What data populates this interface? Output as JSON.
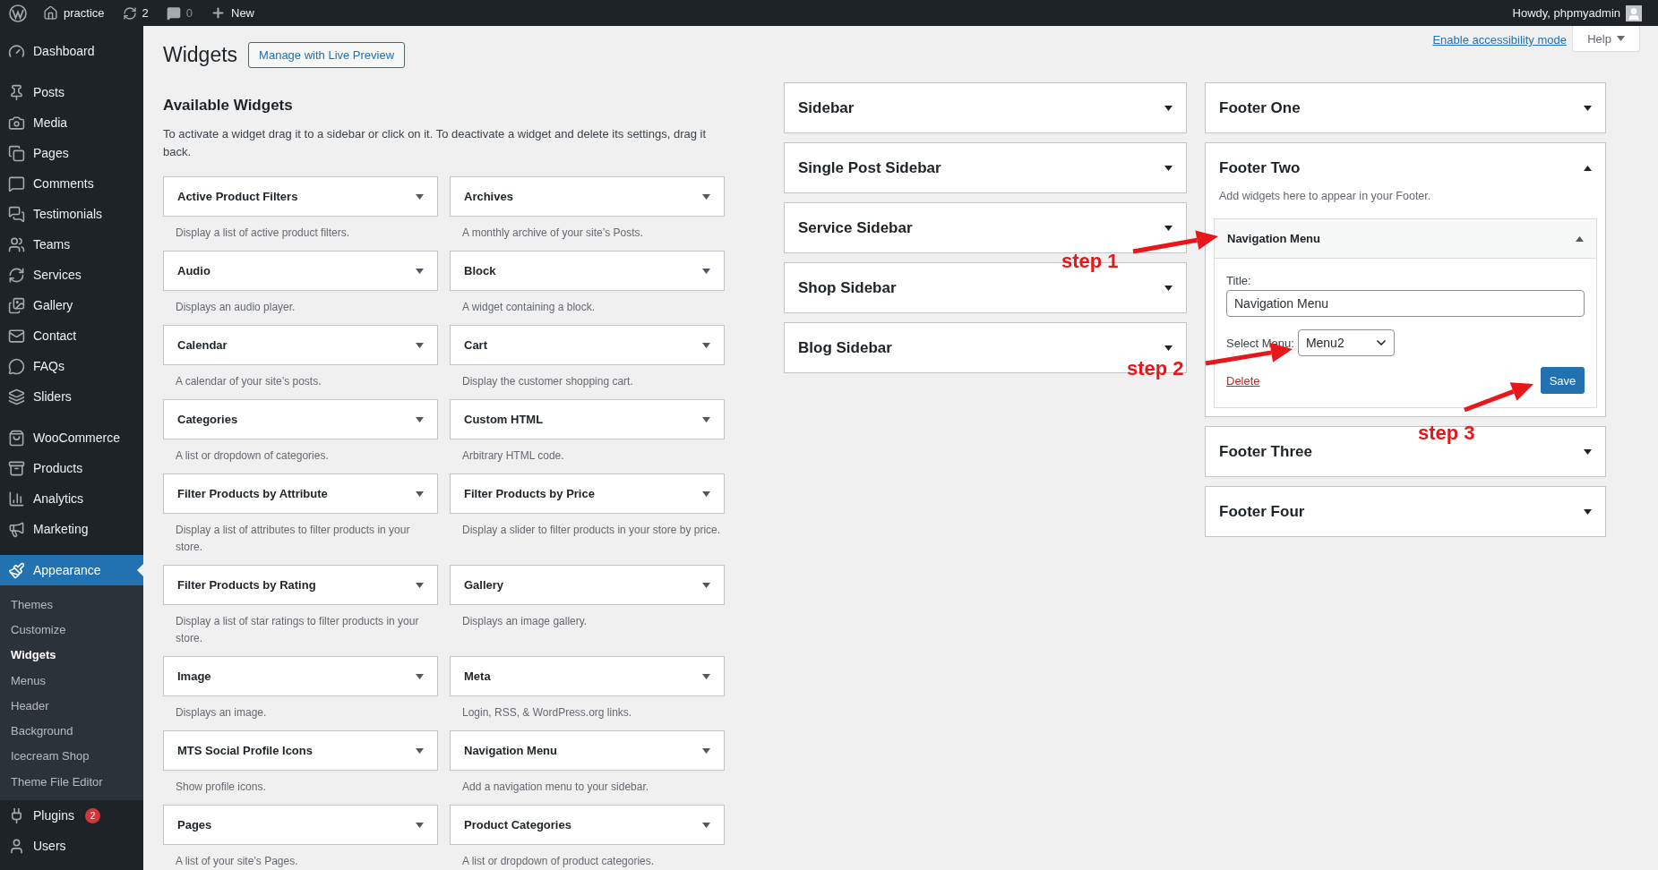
{
  "admin_bar": {
    "site": "practice",
    "updates": "2",
    "comments": "0",
    "new": "New",
    "greeting": "Howdy, phpmyadmin"
  },
  "menu": [
    {
      "items": [
        {
          "label": "Dashboard",
          "selected": false
        }
      ]
    },
    {
      "items": [
        {
          "label": "Posts",
          "selected": false
        },
        {
          "label": "Media",
          "selected": false
        },
        {
          "label": "Pages",
          "selected": false
        },
        {
          "label": "Comments",
          "selected": false
        },
        {
          "label": "Testimonials",
          "selected": false
        },
        {
          "label": "Teams",
          "selected": false
        },
        {
          "label": "Services",
          "selected": false
        },
        {
          "label": "Gallery",
          "selected": false
        },
        {
          "label": "Contact",
          "selected": false
        },
        {
          "label": "FAQs",
          "selected": false
        },
        {
          "label": "Sliders",
          "selected": false
        }
      ]
    },
    {
      "items": [
        {
          "label": "WooCommerce",
          "selected": false
        },
        {
          "label": "Products",
          "selected": false
        },
        {
          "label": "Analytics",
          "selected": false
        },
        {
          "label": "Marketing",
          "selected": false
        }
      ]
    },
    {
      "items": [
        {
          "label": "Appearance",
          "selected": true,
          "children": [
            {
              "label": "Themes",
              "selected": false
            },
            {
              "label": "Customize",
              "selected": false
            },
            {
              "label": "Widgets",
              "selected": true
            },
            {
              "label": "Menus",
              "selected": false
            },
            {
              "label": "Header",
              "selected": false
            },
            {
              "label": "Background",
              "selected": false
            },
            {
              "label": "Icecream Shop",
              "selected": false
            },
            {
              "label": "Theme File Editor",
              "selected": false
            }
          ]
        },
        {
          "label": "Plugins",
          "selected": false,
          "badge": "2"
        },
        {
          "label": "Users",
          "selected": false
        }
      ]
    }
  ],
  "screen_links": {
    "accessibility": "Enable accessibility mode",
    "help": "Help"
  },
  "page": {
    "title": "Widgets",
    "action": "Manage with Live Preview"
  },
  "available": {
    "heading": "Available Widgets",
    "intro": "To activate a widget drag it to a sidebar or click on it. To deactivate a widget and delete its settings, drag it back.",
    "widgets": [
      {
        "title": "Active Product Filters",
        "description": "Display a list of active product filters."
      },
      {
        "title": "Archives",
        "description": "A monthly archive of your site’s Posts."
      },
      {
        "title": "Audio",
        "description": "Displays an audio player."
      },
      {
        "title": "Block",
        "description": "A widget containing a block."
      },
      {
        "title": "Calendar",
        "description": "A calendar of your site’s posts."
      },
      {
        "title": "Cart",
        "description": "Display the customer shopping cart."
      },
      {
        "title": "Categories",
        "description": "A list or dropdown of categories."
      },
      {
        "title": "Custom HTML",
        "description": "Arbitrary HTML code."
      },
      {
        "title": "Filter Products by Attribute",
        "description": "Display a list of attributes to filter products in your store."
      },
      {
        "title": "Filter Products by Price",
        "description": "Display a slider to filter products in your store by price."
      },
      {
        "title": "Filter Products by Rating",
        "description": "Display a list of star ratings to filter products in your store."
      },
      {
        "title": "Gallery",
        "description": "Displays an image gallery."
      },
      {
        "title": "Image",
        "description": "Displays an image."
      },
      {
        "title": "Meta",
        "description": "Login, RSS, & WordPress.org links."
      },
      {
        "title": "MTS Social Profile Icons",
        "description": "Show profile icons."
      },
      {
        "title": "Navigation Menu",
        "description": "Add a navigation menu to your sidebar."
      },
      {
        "title": "Pages",
        "description": "A list of your site’s Pages."
      },
      {
        "title": "Product Categories",
        "description": "A list or dropdown of product categories."
      }
    ]
  },
  "area_columns": [
    {
      "areas": [
        {
          "title": "Sidebar",
          "expanded": false
        },
        {
          "title": "Single Post Sidebar",
          "expanded": false
        },
        {
          "title": "Service Sidebar",
          "expanded": false
        },
        {
          "title": "Shop Sidebar",
          "expanded": false
        },
        {
          "title": "Blog Sidebar",
          "expanded": false
        }
      ]
    },
    {
      "areas": [
        {
          "title": "Footer One",
          "expanded": false
        },
        {
          "title": "Footer Two",
          "expanded": true,
          "description": "Add widgets here to appear in your Footer.",
          "widgets": [
            {
              "title": "Navigation Menu",
              "expanded": true,
              "title_label": "Title:",
              "title_value": "Navigation Menu",
              "select_label": "Select Menu:",
              "select_value": "Menu2",
              "delete": "Delete",
              "save": "Save"
            }
          ]
        },
        {
          "title": "Footer Three",
          "expanded": false
        },
        {
          "title": "Footer Four",
          "expanded": false
        }
      ]
    }
  ],
  "annotations": [
    {
      "label": "step 1"
    },
    {
      "label": "step 2"
    },
    {
      "label": "step 3"
    }
  ]
}
